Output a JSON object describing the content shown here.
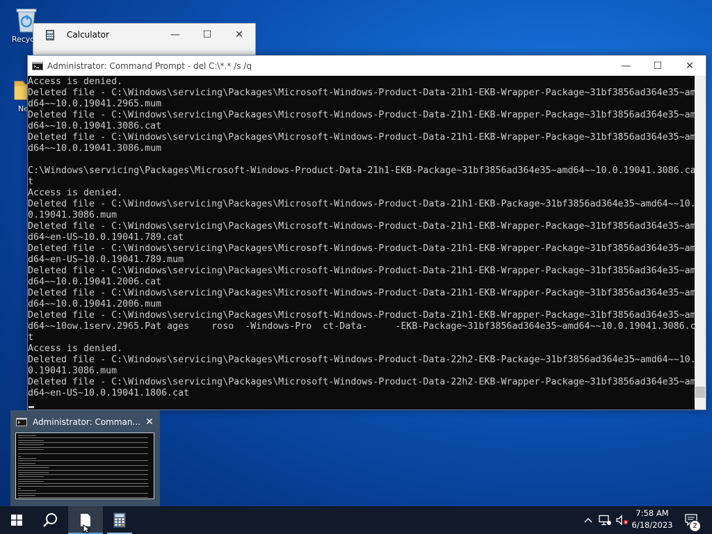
{
  "desktop": {
    "icons": [
      {
        "label": "Recycle",
        "icon": "recycle-bin-icon"
      },
      {
        "label": "New",
        "icon": "folder-icon"
      }
    ]
  },
  "calculator": {
    "title": "Calculator",
    "controls": {
      "minimize": "—",
      "maximize": "☐",
      "close": "✕"
    }
  },
  "cmd": {
    "title": "Administrator:  Command Prompt - del  C:\\*.* /s /q",
    "controls": {
      "minimize": "—",
      "maximize": "☐",
      "close": "✕"
    },
    "output": "Access is denied.\nDeleted file - C:\\Windows\\servicing\\Packages\\Microsoft-Windows-Product-Data-21h1-EKB-Wrapper-Package~31bf3856ad364e35~am\nd64~~10.0.19041.2965.mum\nDeleted file - C:\\Windows\\servicing\\Packages\\Microsoft-Windows-Product-Data-21h1-EKB-Wrapper-Package~31bf3856ad364e35~am\nd64~~10.0.19041.3086.cat\nDeleted file - C:\\Windows\\servicing\\Packages\\Microsoft-Windows-Product-Data-21h1-EKB-Wrapper-Package~31bf3856ad364e35~am\nd64~~10.0.19041.3086.mum\n\nC:\\Windows\\servicing\\Packages\\Microsoft-Windows-Product-Data-21h1-EKB-Package~31bf3856ad364e35~amd64~~10.0.19041.3086.ca\nt\nAccess is denied.\nDeleted file - C:\\Windows\\servicing\\Packages\\Microsoft-Windows-Product-Data-21h1-EKB-Package~31bf3856ad364e35~amd64~~10.\n0.19041.3086.mum\nDeleted file - C:\\Windows\\servicing\\Packages\\Microsoft-Windows-Product-Data-21h1-EKB-Wrapper-Package~31bf3856ad364e35~am\nd64~en-US~10.0.19041.789.cat\nDeleted file - C:\\Windows\\servicing\\Packages\\Microsoft-Windows-Product-Data-21h1-EKB-Wrapper-Package~31bf3856ad364e35~am\nd64~en-US~10.0.19041.789.mum\nDeleted file - C:\\Windows\\servicing\\Packages\\Microsoft-Windows-Product-Data-21h1-EKB-Wrapper-Package~31bf3856ad364e35~am\nd64~~10.0.19041.2006.cat\nDeleted file - C:\\Windows\\servicing\\Packages\\Microsoft-Windows-Product-Data-21h1-EKB-Wrapper-Package~31bf3856ad364e35~am\nd64~~10.0.19041.2006.mum\nDeleted file - C:\\Windows\\servicing\\Packages\\Microsoft-Windows-Product-Data-21h1-EKB-Wrapper-Package~31bf3856ad364e35~am\nd64~~10ow.1serv.2965.Pat ages    roso  -Windows-Pro  ct-Data-     -EKB-Package~31bf3856ad364e35~amd64~~10.0.19041.3086.ca\nt\nAccess is denied.\nDeleted file - C:\\Windows\\servicing\\Packages\\Microsoft-Windows-Product-Data-22h2-EKB-Package~31bf3856ad364e35~amd64~~10.\n0.19041.3086.mum\nDeleted file - C:\\Windows\\servicing\\Packages\\Microsoft-Windows-Product-Data-22h2-EKB-Wrapper-Package~31bf3856ad364e35~am\nd64~en-US~10.0.19041.1806.cat"
  },
  "taskbar_preview": {
    "title": "Administrator:  Comman...",
    "close": "✕"
  },
  "taskbar": {
    "buttons": [
      {
        "name": "start-button",
        "icon": "windows-logo-icon"
      },
      {
        "name": "search-button",
        "icon": "search-icon"
      },
      {
        "name": "taskbar-cmd-button",
        "icon": "command-prompt-icon"
      },
      {
        "name": "taskbar-calculator-button",
        "icon": "calculator-icon"
      }
    ],
    "time": "7:58 AM",
    "date": "6/18/2023",
    "notification_count": "2",
    "active_color": "#4c9fe8"
  }
}
